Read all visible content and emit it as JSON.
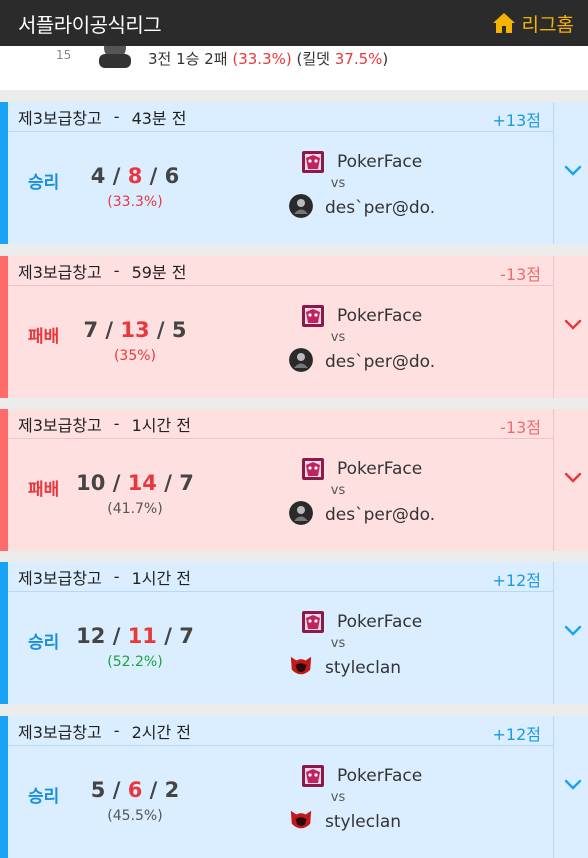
{
  "app": {
    "title": "서플라이공식리그",
    "home_label": "리그홈"
  },
  "summary": {
    "number": "15",
    "prefix": "3전 1승 2패",
    "rate": "(33.3%)",
    "kill_label": "킬뎃",
    "kill_rate": "37.5%",
    "suffix": ")"
  },
  "matches": [
    {
      "map": "제3보급창고",
      "time": "43분 전",
      "points": "+13점",
      "result": "승리",
      "kills": "4",
      "deaths": "8",
      "assists": "6",
      "rate": "(33.3%)",
      "rate_color": "#e8383d",
      "team1": "PokerFace",
      "vs": "vs",
      "team2": "des`per@do.",
      "team2_logo": "desperado-icon",
      "outcome": "win"
    },
    {
      "map": "제3보급창고",
      "time": "59분 전",
      "points": "-13점",
      "result": "패배",
      "kills": "7",
      "deaths": "13",
      "assists": "5",
      "rate": "(35%)",
      "rate_color": "#e8383d",
      "team1": "PokerFace",
      "vs": "vs",
      "team2": "des`per@do.",
      "team2_logo": "desperado-icon",
      "outcome": "loss"
    },
    {
      "map": "제3보급창고",
      "time": "1시간 전",
      "points": "-13점",
      "result": "패배",
      "kills": "10",
      "deaths": "14",
      "assists": "7",
      "rate": "(41.7%)",
      "rate_color": "#555555",
      "team1": "PokerFace",
      "vs": "vs",
      "team2": "des`per@do.",
      "team2_logo": "desperado-icon",
      "outcome": "loss"
    },
    {
      "map": "제3보급창고",
      "time": "1시간 전",
      "points": "+12점",
      "result": "승리",
      "kills": "12",
      "deaths": "11",
      "assists": "7",
      "rate": "(52.2%)",
      "rate_color": "#1aa33a",
      "team1": "PokerFace",
      "vs": "vs",
      "team2": "styleclan",
      "team2_logo": "styleclan-icon",
      "outcome": "win"
    },
    {
      "map": "제3보급창고",
      "time": "2시간 전",
      "points": "+12점",
      "result": "승리",
      "kills": "5",
      "deaths": "6",
      "assists": "2",
      "rate": "(45.5%)",
      "rate_color": "#555555",
      "team1": "PokerFace",
      "vs": "vs",
      "team2": "styleclan",
      "team2_logo": "styleclan-icon",
      "outcome": "win"
    }
  ],
  "colors": {
    "win_bg": "#dbeeff",
    "loss_bg": "#ffe0e0",
    "win_accent": "#18a3f5",
    "loss_accent": "#ff6b6b",
    "brand": "#f5b301"
  }
}
